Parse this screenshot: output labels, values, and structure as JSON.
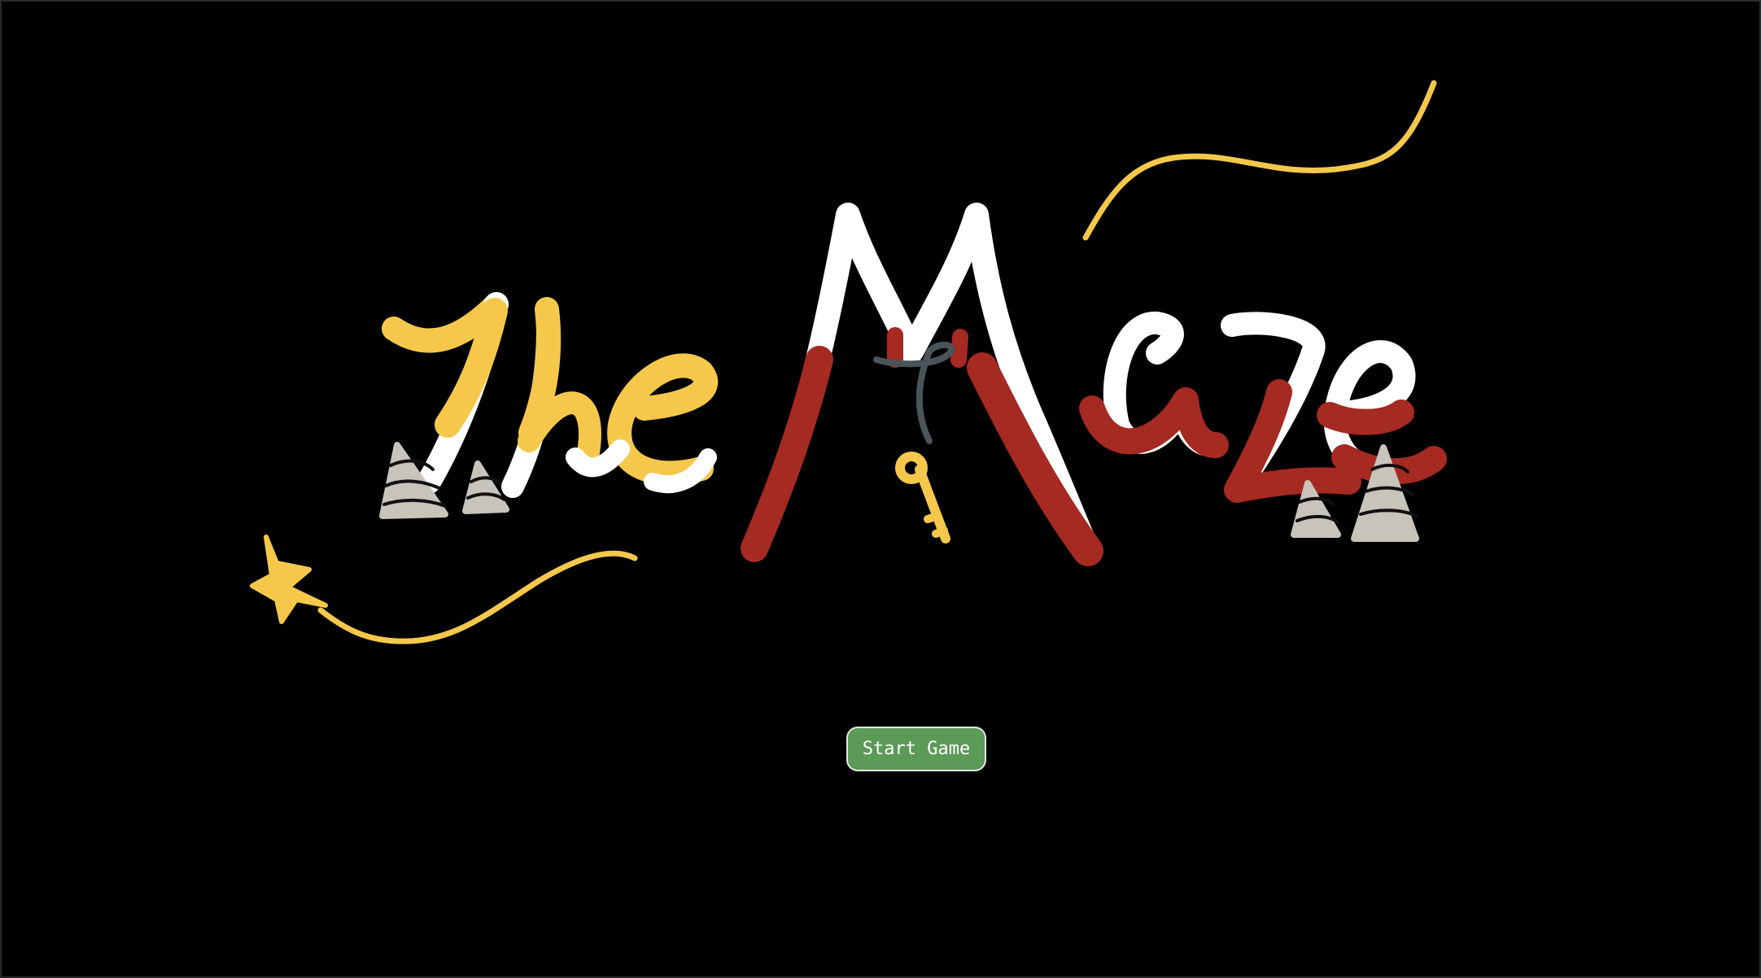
{
  "game": {
    "title": "The Maze"
  },
  "menu": {
    "start_label": "Start Game"
  },
  "colors": {
    "background": "#000000",
    "title_yellow": "#f5c84b",
    "title_red": "#a52a22",
    "title_white": "#ffffff",
    "cone_gray": "#c8c4bc",
    "button_green": "#5b9a57"
  },
  "icons": [
    "star-icon",
    "key-icon",
    "cone-icon",
    "swirl-line-icon"
  ]
}
